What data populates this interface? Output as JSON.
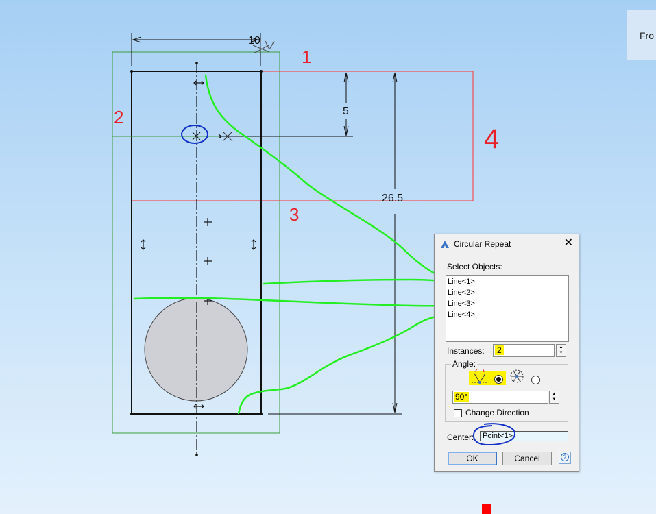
{
  "side_tab": {
    "label": "Fro"
  },
  "drawing": {
    "dim_top": "10",
    "dim_small": "5",
    "dim_vertical": "26.5",
    "annotations": [
      "1",
      "2",
      "3",
      "4"
    ]
  },
  "dialog": {
    "title": "Circular Repeat",
    "close_glyph": "✕",
    "select_label": "Select Objects:",
    "objects": [
      "Line<1>",
      "Line<2>",
      "Line<3>",
      "Line<4>"
    ],
    "instances_label": "Instances:",
    "instances_value": "2",
    "angle_label": "Angle:",
    "angle_value": "90°",
    "change_direction_label": "Change Direction",
    "change_direction_checked": false,
    "center_label": "Center:",
    "center_value": "Point<1>",
    "ok_label": "OK",
    "cancel_label": "Cancel",
    "help_glyph": "?"
  },
  "colors": {
    "annotation_green": "#22ee22",
    "annotation_red": "#e8202a",
    "annotation_blue": "#1030c8",
    "highlight": "#fff200",
    "selection_box": "#ff3333"
  }
}
